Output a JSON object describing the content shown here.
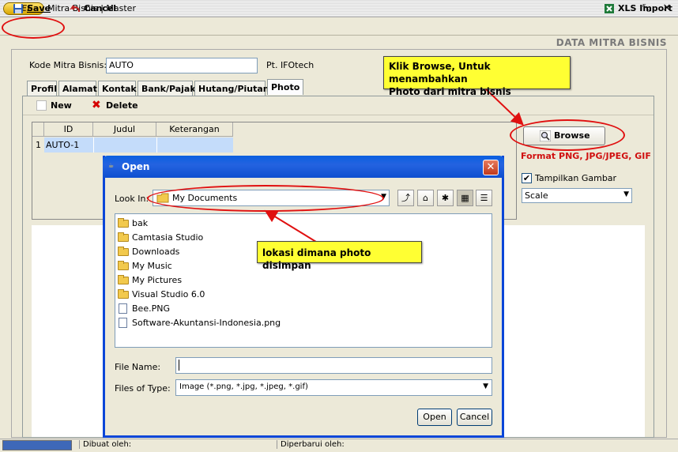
{
  "window": {
    "logo": "BEE",
    "title": "Mitra Bisnis | Master"
  },
  "toolbar": {
    "save_label": "Save",
    "cancel_label": "Cancel",
    "xls_label": "XLS Import"
  },
  "section_title": "DATA MITRA BISNIS",
  "form": {
    "kode_label": "Kode Mitra Bisnis:",
    "kode_value": "AUTO",
    "company_name": "Pt. IFOtech"
  },
  "tabs": [
    {
      "label": "Profil"
    },
    {
      "label": "Alamat"
    },
    {
      "label": "Kontak"
    },
    {
      "label": "Bank/Pajak"
    },
    {
      "label": "Hutang/Piutang"
    },
    {
      "label": "Photo"
    }
  ],
  "subtoolbar": {
    "new_label": "New",
    "delete_label": "Delete"
  },
  "grid": {
    "columns": [
      "ID",
      "Judul",
      "Keterangan"
    ],
    "rows": [
      {
        "num": "1",
        "id": "AUTO-1",
        "judul": "",
        "keterangan": ""
      }
    ]
  },
  "photo_panel": {
    "browse_label": "Browse",
    "format_note": "Format PNG, JPG/JPEG, GIF",
    "tampilkan_label": "Tampilkan Gambar",
    "tampilkan_checked": true,
    "scale_value": "Scale"
  },
  "status": {
    "created_label": "Dibuat oleh:",
    "updated_label": "Diperbarui oleh:"
  },
  "dialog": {
    "title": "Open",
    "lookin_label": "Look In:",
    "lookin_value": "My Documents",
    "files": [
      {
        "name": "bak",
        "type": "folder"
      },
      {
        "name": "Camtasia Studio",
        "type": "folder"
      },
      {
        "name": "Downloads",
        "type": "folder"
      },
      {
        "name": "My Music",
        "type": "folder"
      },
      {
        "name": "My Pictures",
        "type": "folder"
      },
      {
        "name": "Visual Studio 6.0",
        "type": "folder"
      },
      {
        "name": "Bee.PNG",
        "type": "file"
      },
      {
        "name": "Software-Akuntansi-Indonesia.png",
        "type": "file"
      }
    ],
    "filename_label": "File Name:",
    "filename_value": "",
    "filetype_label": "Files of Type:",
    "filetype_value": "Image (*.png, *.jpg, *.jpeg, *.gif)",
    "open_label": "Open",
    "cancel_label": "Cancel"
  },
  "callouts": {
    "browse_line1": "Klik Browse, Untuk menambahkan",
    "browse_line2": "Photo dari mitra bisnis",
    "location": "lokasi dimana photo disimpan"
  },
  "colors": {
    "dialog_title": "#0a5fe0",
    "callout_bg": "#ffff33",
    "annotation_red": "#e01010",
    "format_note": "#d01010",
    "selection": "#c4dcfa"
  }
}
